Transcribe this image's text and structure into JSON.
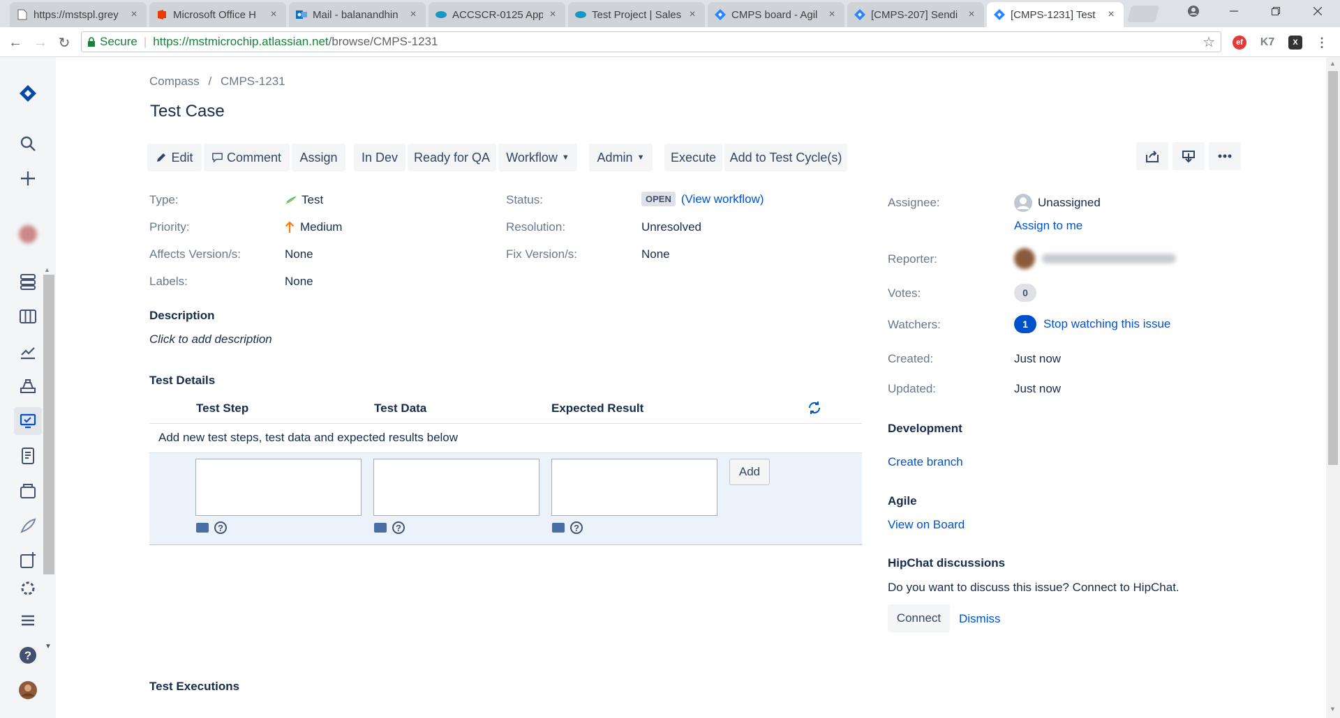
{
  "browser": {
    "tabs": [
      {
        "title": "https://mstspl.grey",
        "icon": "page-icon"
      },
      {
        "title": "Microsoft Office H",
        "icon": "office-icon"
      },
      {
        "title": "Mail - balanandhin",
        "icon": "outlook-icon"
      },
      {
        "title": "ACCSCR-0125 App",
        "icon": "salesforce-icon"
      },
      {
        "title": "Test Project | Sales",
        "icon": "salesforce-icon"
      },
      {
        "title": "CMPS board - Agil",
        "icon": "jira-icon"
      },
      {
        "title": "[CMPS-207] Sendi",
        "icon": "jira-icon"
      },
      {
        "title": "[CMPS-1231] Test",
        "icon": "jira-icon"
      }
    ],
    "tab_close": "×",
    "secure_label": "Secure",
    "url_host": "https://mstmicrochip.atlassian.net",
    "url_path": "/browse/CMPS-1231",
    "colors": {
      "secure": "#188038",
      "tabstrip": "#dee1e6"
    }
  },
  "breadcrumb": {
    "project": "Compass",
    "separator": "/",
    "issue_key": "CMPS-1231"
  },
  "issue": {
    "summary": "Test Case"
  },
  "toolbar": {
    "edit": "Edit",
    "comment": "Comment",
    "assign": "Assign",
    "in_dev": "In Dev",
    "ready_for_qa": "Ready for QA",
    "workflow": "Workflow",
    "admin": "Admin",
    "execute": "Execute",
    "add_to_test_cycle": "Add to Test Cycle(s)"
  },
  "details": {
    "type_label": "Type:",
    "type_value": "Test",
    "priority_label": "Priority:",
    "priority_value": "Medium",
    "affects_label": "Affects Version/s:",
    "affects_value": "None",
    "labels_label": "Labels:",
    "labels_value": "None",
    "status_label": "Status:",
    "status_value": "OPEN",
    "view_workflow": "(View workflow)",
    "resolution_label": "Resolution:",
    "resolution_value": "Unresolved",
    "fix_label": "Fix Version/s:",
    "fix_value": "None"
  },
  "description": {
    "heading": "Description",
    "placeholder": "Click to add description"
  },
  "test_details": {
    "heading": "Test Details",
    "columns": [
      "Test Step",
      "Test Data",
      "Expected Result"
    ],
    "hint": "Add new test steps, test data and expected results below",
    "add_button": "Add",
    "help_glyph": "?"
  },
  "test_executions": {
    "heading": "Test Executions"
  },
  "people": {
    "assignee_label": "Assignee:",
    "assignee_value": "Unassigned",
    "assign_to_me": "Assign to me",
    "reporter_label": "Reporter:",
    "votes_label": "Votes:",
    "votes_count": "0",
    "watchers_label": "Watchers:",
    "watchers_count": "1",
    "stop_watching": "Stop watching this issue",
    "created_label": "Created:",
    "created_value": "Just now",
    "updated_label": "Updated:",
    "updated_value": "Just now"
  },
  "development": {
    "heading": "Development",
    "create_branch": "Create branch"
  },
  "agile": {
    "heading": "Agile",
    "view_on_board": "View on Board"
  },
  "hipchat": {
    "heading": "HipChat discussions",
    "prompt": "Do you want to discuss this issue? Connect to HipChat.",
    "connect": "Connect",
    "dismiss": "Dismiss"
  },
  "colors": {
    "link": "#0052cc",
    "jira_blue": "#2684ff",
    "priority_orange": "#ff7a00",
    "table_bg": "#ebf2f9"
  }
}
